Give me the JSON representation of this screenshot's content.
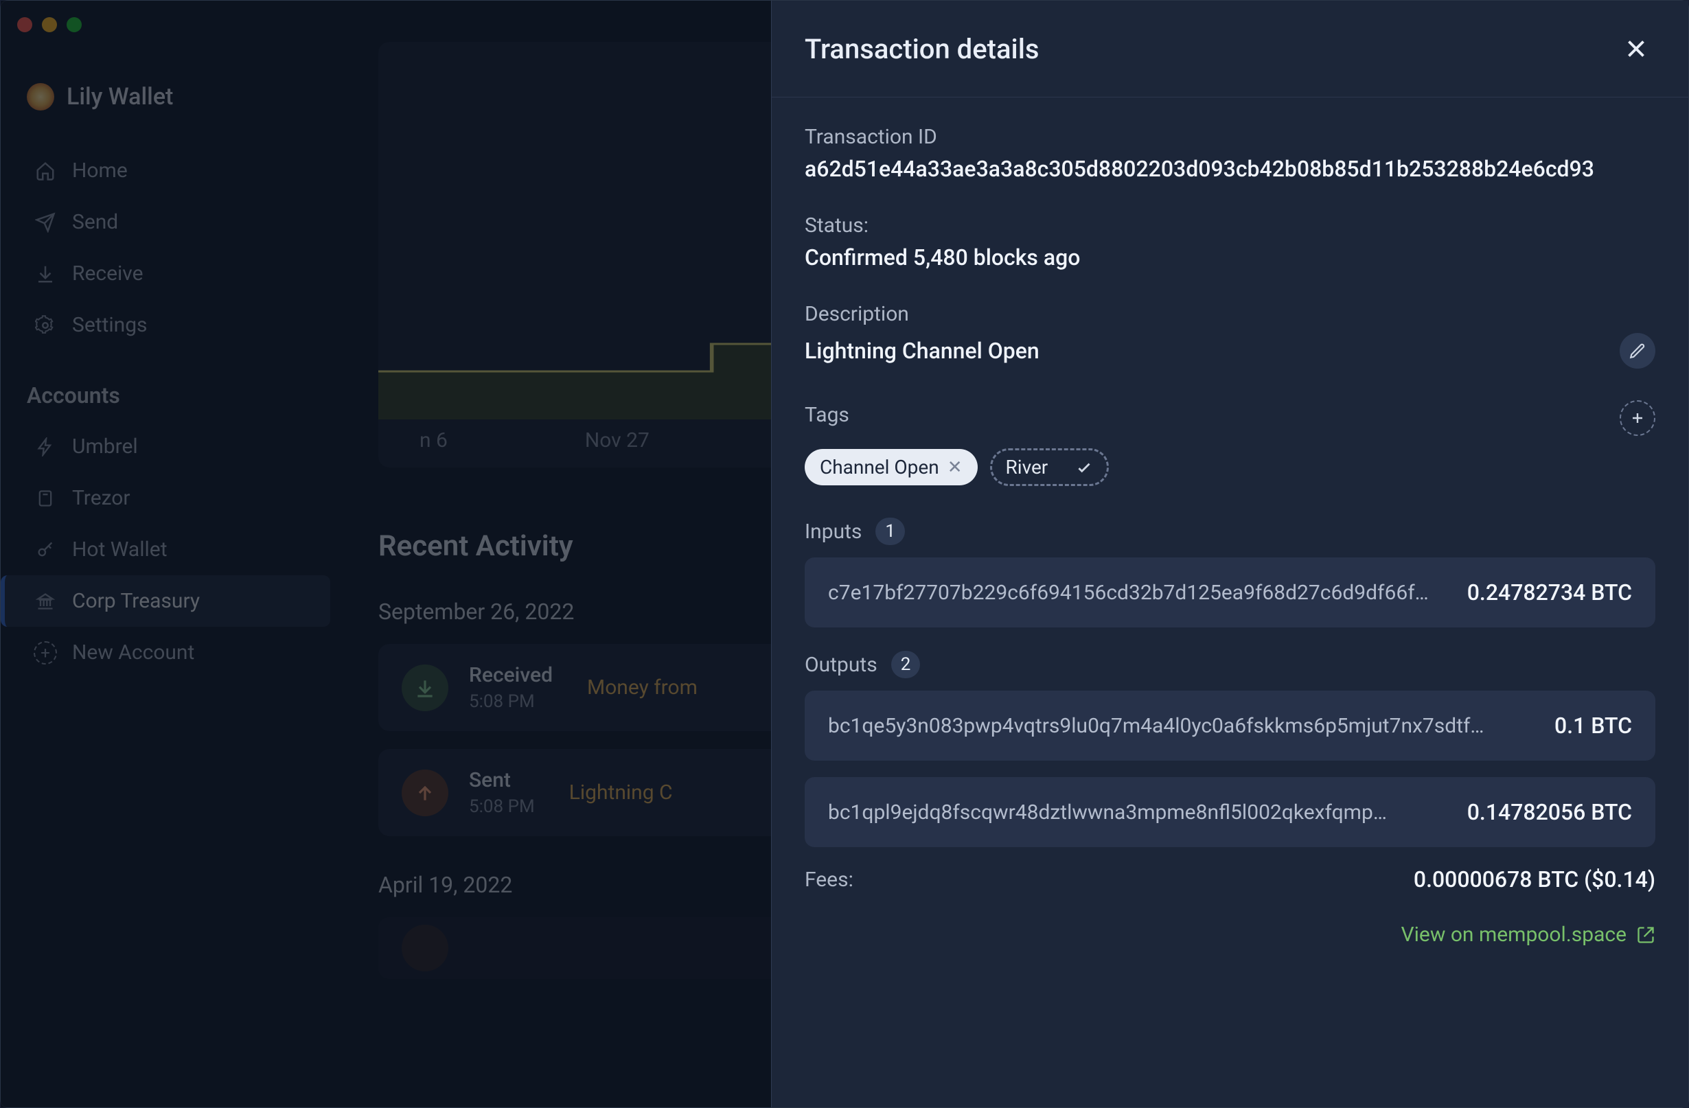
{
  "brand": "Lily Wallet",
  "nav": {
    "home": "Home",
    "send": "Send",
    "receive": "Receive",
    "settings": "Settings"
  },
  "accounts": {
    "heading": "Accounts",
    "items": [
      {
        "label": "Umbrel"
      },
      {
        "label": "Trezor"
      },
      {
        "label": "Hot Wallet"
      },
      {
        "label": "Corp Treasury"
      }
    ],
    "new": "New Account"
  },
  "chart": {
    "tick0": "n 6",
    "tick1": "Nov 27"
  },
  "activity": {
    "heading": "Recent Activity",
    "groups": [
      {
        "date": "September 26, 2022",
        "rows": [
          {
            "kind": "Received",
            "time": "5:08 PM",
            "desc": "Money from"
          },
          {
            "kind": "Sent",
            "time": "5:08 PM",
            "desc": "Lightning C"
          }
        ]
      },
      {
        "date": "April 19, 2022",
        "rows": []
      }
    ]
  },
  "drawer": {
    "title": "Transaction details",
    "txid_label": "Transaction ID",
    "txid": "a62d51e44a33ae3a3a8c305d8802203d093cb42b08b85d11b253288b24e6cd93",
    "status_label": "Status:",
    "status": "Confirmed 5,480 blocks ago",
    "desc_label": "Description",
    "desc": "Lightning Channel Open",
    "tags_label": "Tags",
    "tags": [
      {
        "label": "Channel Open"
      }
    ],
    "tag_input": "River",
    "inputs_label": "Inputs",
    "inputs_count": "1",
    "inputs": [
      {
        "addr": "c7e17bf27707b229c6f694156cd32b7d125ea9f68d27c6d9df66f…",
        "amt": "0.24782734 BTC"
      }
    ],
    "outputs_label": "Outputs",
    "outputs_count": "2",
    "outputs": [
      {
        "addr": "bc1qe5y3n083pwp4vqtrs9lu0q7m4a4l0yc0a6fskkms6p5mjut7nx7sdtf…",
        "amt": "0.1 BTC"
      },
      {
        "addr": "bc1qpl9ejdq8fscqwr48dztlwwna3mpme8nfl5l002qkexfqmp…",
        "amt": "0.14782056 BTC"
      }
    ],
    "fees_label": "Fees:",
    "fees": "0.00000678 BTC ($0.14)",
    "view_link": "View on mempool.space"
  }
}
